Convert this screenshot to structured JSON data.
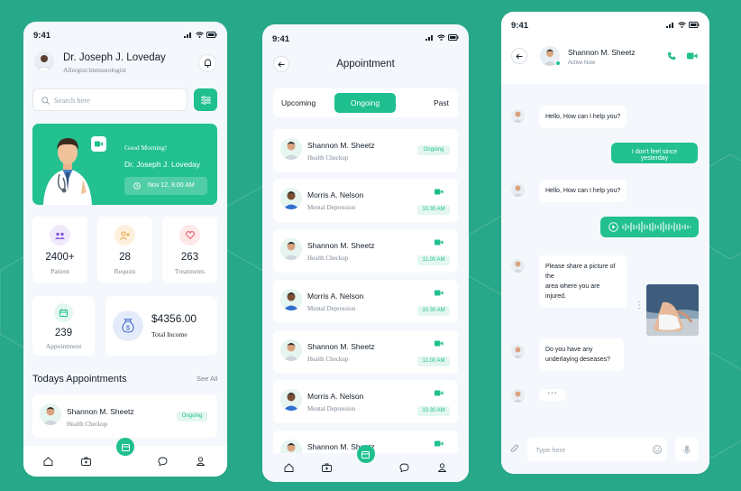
{
  "colors": {
    "background": "#27a889",
    "accent": "#1fbf8f",
    "screen": "#f4f7fb",
    "text": "#16212b"
  },
  "status_time": "9:41",
  "dashboard": {
    "doctor_name": "Dr. Joseph J. Loveday",
    "doctor_title": "Allergist/immunologist",
    "search_placeholder": "Search here",
    "banner": {
      "greeting": "Good Morning!",
      "name": "Dr. Joseph J. Loveday",
      "date": "Nov 12, 8.00 AM"
    },
    "stats": [
      {
        "value": "2400+",
        "label": "Patient",
        "icon": "users-icon"
      },
      {
        "value": "28",
        "label": "Requsts",
        "icon": "user-plus-icon"
      },
      {
        "value": "263",
        "label": "Treatments",
        "icon": "heart-icon"
      }
    ],
    "appointment_stat": {
      "value": "239",
      "label": "Appointment"
    },
    "income": {
      "value": "$4356.00",
      "label": "Total Income"
    },
    "todays_title": "Todays Appointments",
    "see_all": "See All",
    "todays_item": {
      "name": "Shannon M. Sheetz",
      "sub": "Health Checkup",
      "status": "Ongoing"
    }
  },
  "appointment": {
    "title": "Appointment",
    "tabs": [
      "Upcoming",
      "Ongoing",
      "Past"
    ],
    "active_tab": "Ongoing",
    "items": [
      {
        "name": "Shannon M. Sheetz",
        "sub": "Health Checkup",
        "tag": "Ongoing"
      },
      {
        "name": "Morris A. Nelson",
        "sub": "Mental Depression",
        "tag": "10.30 AM"
      },
      {
        "name": "Shannon M. Sheetz",
        "sub": "Health Checkup",
        "tag": "11.00 AM"
      },
      {
        "name": "Morris A. Nelson",
        "sub": "Mental Depression",
        "tag": "10.30 AM"
      },
      {
        "name": "Shannon M. Sheetz",
        "sub": "Health Checkup",
        "tag": "11.00 AM"
      },
      {
        "name": "Morris A. Nelson",
        "sub": "Mental Depression",
        "tag": "10.30 AM"
      },
      {
        "name": "Shannon M. Sheetz",
        "sub": "Health Checkup",
        "tag": ""
      }
    ]
  },
  "chat": {
    "contact_name": "Shannon M. Sheetz",
    "contact_status": "Active Now",
    "messages": [
      {
        "from": "them",
        "text": "Hello, How can I help you?"
      },
      {
        "from": "me",
        "text": "I don't feel since yesterday"
      },
      {
        "from": "them",
        "text": "Hello, How can I help you?"
      },
      {
        "from": "me",
        "text": "voice message"
      },
      {
        "from": "them",
        "text": "Please share a picture of the area where you are injured."
      },
      {
        "from": "me",
        "text": "image"
      },
      {
        "from": "them",
        "text": "Do you have any underlaying deseases?"
      },
      {
        "from": "them",
        "text": "typing"
      }
    ],
    "bubble_texts": {
      "m1": "Hello, How can I help you?",
      "m2": "I don't feel since yesterday",
      "m3": "Hello, How can I help you?",
      "m5a": "Please share a picture of the",
      "m5b": "area where you are injured.",
      "m7a": "Do you have any",
      "m7b": "underlaying deseases?"
    },
    "input_placeholder": "Type here"
  }
}
